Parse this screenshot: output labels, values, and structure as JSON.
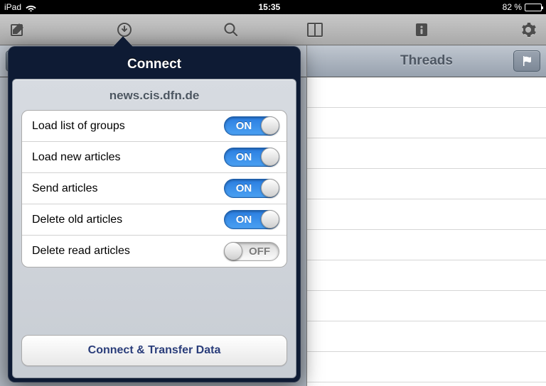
{
  "status": {
    "device": "iPad",
    "time": "15:35",
    "battery_pct": "82 %",
    "battery_fill": 82
  },
  "toolbar_icons": [
    "compose-icon",
    "download-icon",
    "search-icon",
    "columns-icon",
    "info-icon",
    "gear-icon"
  ],
  "threads": {
    "title": "Threads",
    "row_count": 10
  },
  "popover": {
    "title": "Connect",
    "server": "news.cis.dfn.de",
    "on_label": "ON",
    "off_label": "OFF",
    "options": [
      {
        "label": "Load list of groups",
        "on": true
      },
      {
        "label": "Load new articles",
        "on": true
      },
      {
        "label": "Send articles",
        "on": true
      },
      {
        "label": "Delete old articles",
        "on": true
      },
      {
        "label": "Delete read articles",
        "on": false
      }
    ],
    "action": "Connect & Transfer Data"
  }
}
